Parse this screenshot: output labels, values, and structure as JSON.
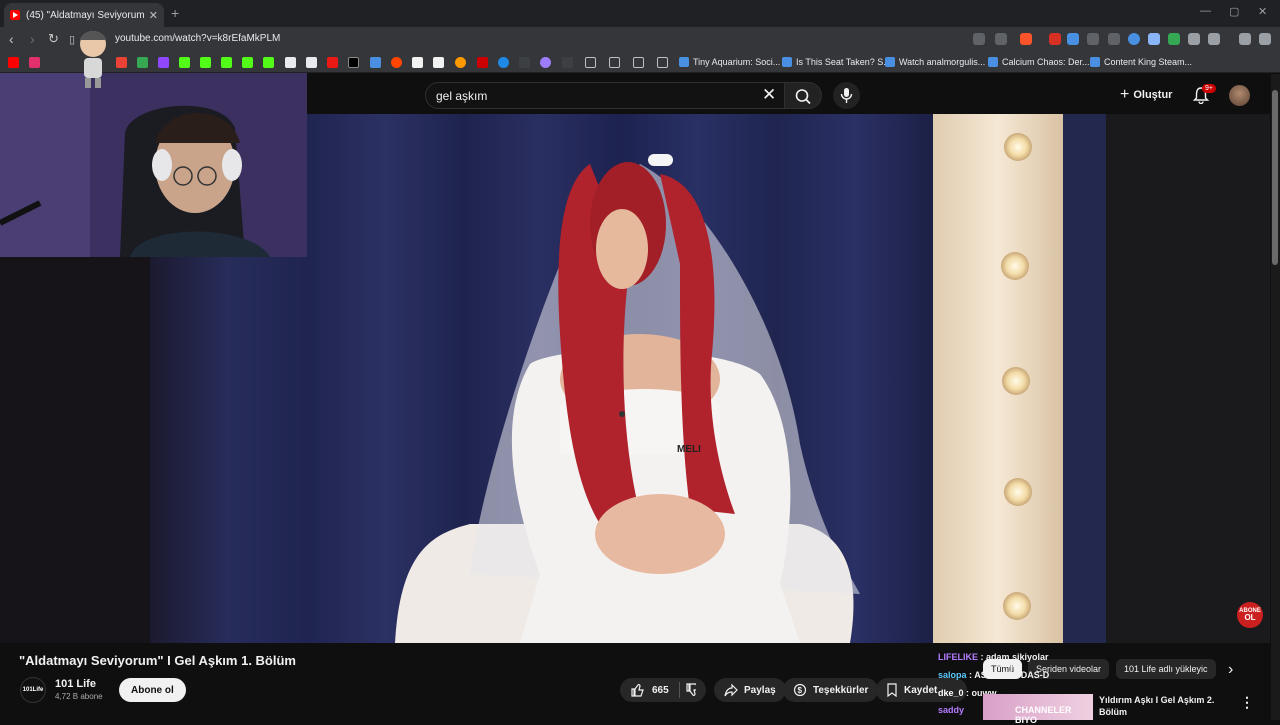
{
  "browser": {
    "tab_title": "(45) \"Aldatmayı Seviyorum\" I Ge",
    "tab_close": "✕",
    "new_tab": "+",
    "url": "youtube.com/watch?v=k8rEfaMkPLM",
    "bookmarks": [
      {
        "label": "Tiny Aquarium: Soci..."
      },
      {
        "label": "Is This Seat Taken? S..."
      },
      {
        "label": "Watch analmorgulis..."
      },
      {
        "label": "Calcium Chaos: Der..."
      },
      {
        "label": "Content King Steam..."
      }
    ]
  },
  "youtube": {
    "search_query": "gel aşkım",
    "create_label": "Oluştur",
    "notifications": "9+",
    "video_title": "\"Aldatmayı Seviyorum\" I Gel Aşkım 1. Bölüm",
    "channel_name": "101 Life",
    "channel_logo": "101Life",
    "subscribers": "4,72 B abone",
    "subscribe_label": "Abone ol",
    "likes": "665",
    "share_label": "Paylaş",
    "thanks_label": "Teşekkürler",
    "save_label": "Kaydet",
    "chips": [
      "Tümü",
      "Seriden videolar",
      "101 Life adlı yükleyic"
    ],
    "next_video_title": "Yıldırım Aşkı I Gel Aşkım 2. Bölüm",
    "badge_top": "ABONE",
    "badge_bottom": "OL",
    "video_name_tag": "MELI"
  },
  "chat": [
    {
      "user": "LIFELIKE",
      "message": ": adam sikiyolar",
      "color": "#b57cff"
    },
    {
      "user": "salopa",
      "message": ": ASD0-ASODAS-D",
      "color": "#5ac8fa"
    },
    {
      "user": "dke_0",
      "message": ": ouww",
      "color": "#ffffff"
    },
    {
      "user": "saddy",
      "message": "",
      "color": "#b57cff"
    }
  ],
  "overlay_text": "CHANNELER BIYO"
}
